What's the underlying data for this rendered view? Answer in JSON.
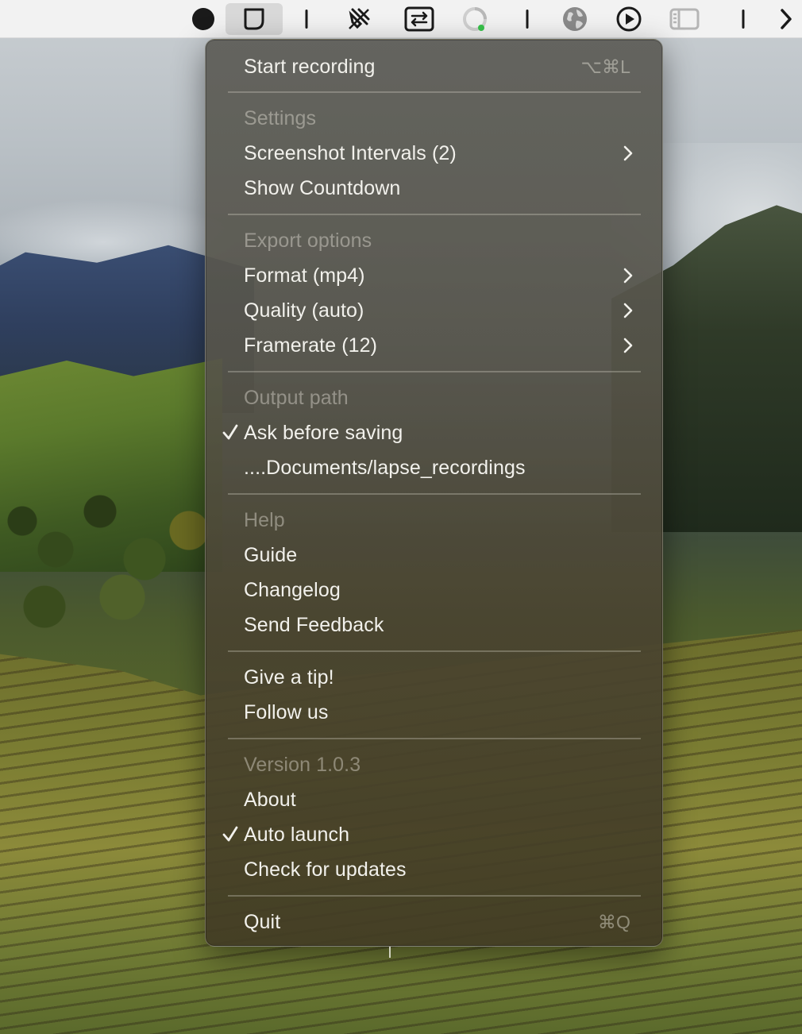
{
  "menubar": {
    "items": [
      {
        "icon": "record-dot-icon"
      },
      {
        "icon": "lapse-app-icon",
        "active": true
      },
      {
        "icon": "divider-bar-icon"
      },
      {
        "icon": "crossed-cursor-icon"
      },
      {
        "icon": "screen-swap-icon"
      },
      {
        "icon": "loading-ring-icon"
      },
      {
        "icon": "divider-bar-icon"
      },
      {
        "icon": "globe-icon"
      },
      {
        "icon": "play-circle-icon"
      },
      {
        "icon": "sidebar-layout-icon"
      },
      {
        "icon": "divider-bar-icon"
      },
      {
        "icon": "chevron-right-icon"
      }
    ]
  },
  "menu": {
    "start_recording": {
      "label": "Start recording",
      "shortcut": "⌥⌘L"
    },
    "settings_header": "Settings",
    "screenshot_intervals": "Screenshot Intervals (2)",
    "show_countdown": "Show Countdown",
    "export_header": "Export options",
    "format": "Format (mp4)",
    "quality": "Quality (auto)",
    "framerate": "Framerate (12)",
    "output_header": "Output path",
    "ask_before_saving": {
      "label": "Ask before saving",
      "checked": true
    },
    "output_path": "....Documents/lapse_recordings",
    "help_header": "Help",
    "guide": "Guide",
    "changelog": "Changelog",
    "send_feedback": "Send Feedback",
    "give_tip": "Give a tip!",
    "follow_us": "Follow us",
    "version": "Version 1.0.3",
    "about": "About",
    "auto_launch": {
      "label": "Auto launch",
      "checked": true
    },
    "check_updates": "Check for updates",
    "quit": {
      "label": "Quit",
      "shortcut": "⌘Q"
    }
  },
  "colors": {
    "menu_text": "#f2f1ec",
    "menu_header_text": "#8f8c80",
    "menubar_bg": "#f2f2f2"
  }
}
